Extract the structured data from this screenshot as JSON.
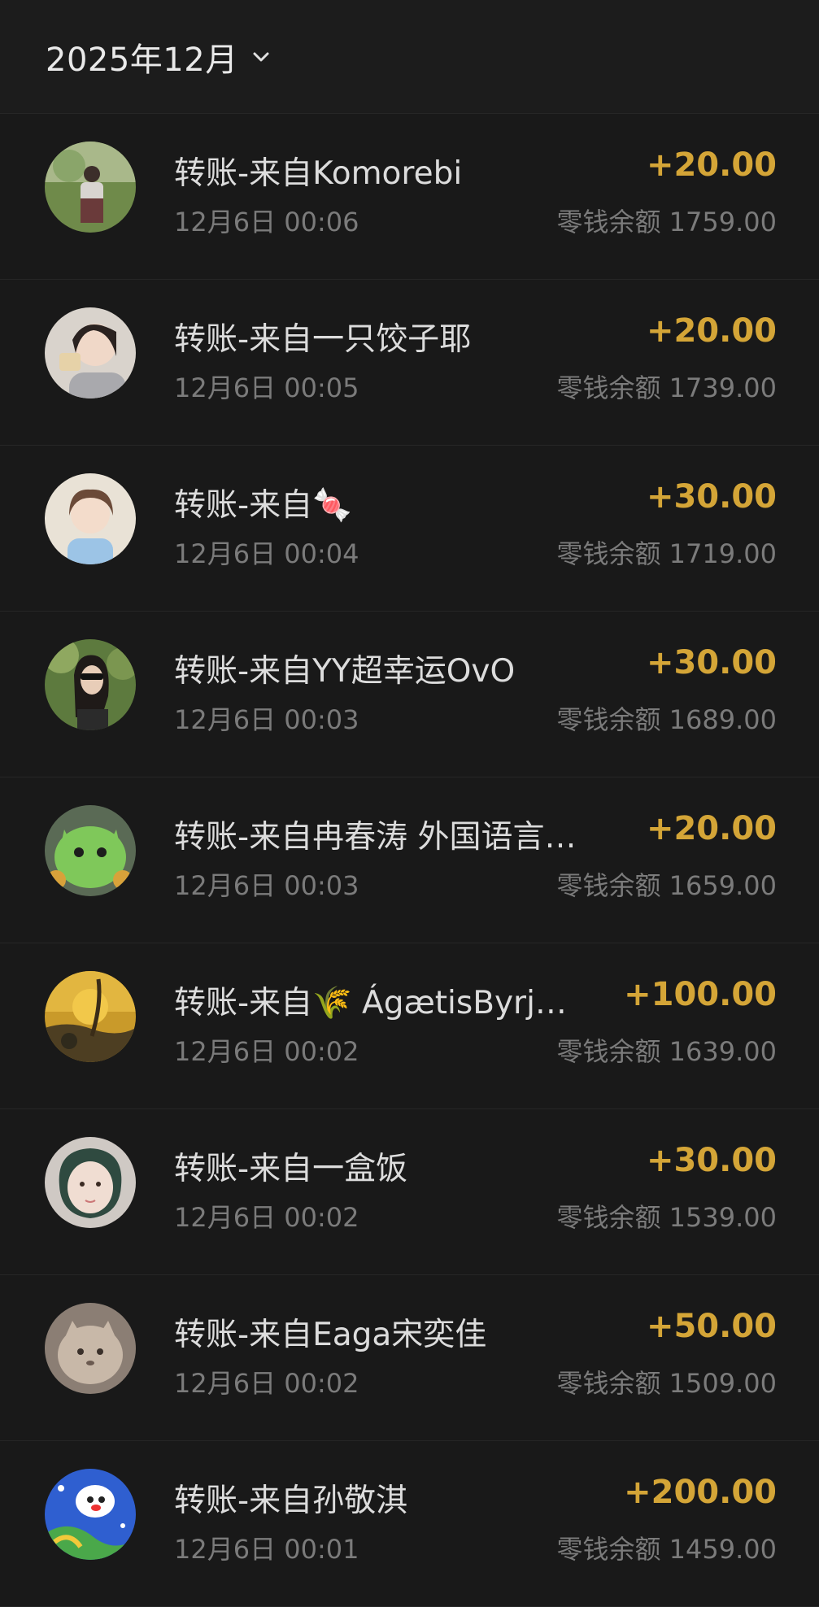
{
  "header": {
    "month_label": "2025年12月",
    "chevron_icon": "chevron-down-icon"
  },
  "colors": {
    "amount": "#d4a537",
    "background": "#191919",
    "header_background": "#1c1c1c"
  },
  "transactions": [
    {
      "title": "转账-来自Komorebi",
      "time": "12月6日 00:06",
      "amount": "+20.00",
      "balance": "零钱余额 1759.00"
    },
    {
      "title": "转账-来自一只饺子耶",
      "time": "12月6日 00:05",
      "amount": "+20.00",
      "balance": "零钱余额 1739.00"
    },
    {
      "title": "转账-来自🍬",
      "time": "12月6日 00:04",
      "amount": "+30.00",
      "balance": "零钱余额 1719.00"
    },
    {
      "title": "转账-来自YY超幸运OvO",
      "time": "12月6日 00:03",
      "amount": "+30.00",
      "balance": "零钱余额 1689.00"
    },
    {
      "title": "转账-来自冉春涛 外国语言…",
      "time": "12月6日 00:03",
      "amount": "+20.00",
      "balance": "零钱余额 1659.00"
    },
    {
      "title": "转账-来自🌾 ÁgætisByrj…",
      "time": "12月6日 00:02",
      "amount": "+100.00",
      "balance": "零钱余额 1639.00"
    },
    {
      "title": "转账-来自一盒饭",
      "time": "12月6日 00:02",
      "amount": "+30.00",
      "balance": "零钱余额 1539.00"
    },
    {
      "title": "转账-来自Eaga宋奕佳",
      "time": "12月6日 00:02",
      "amount": "+50.00",
      "balance": "零钱余额 1509.00"
    },
    {
      "title": "转账-来自孙敬淇",
      "time": "12月6日 00:01",
      "amount": "+200.00",
      "balance": "零钱余额 1459.00"
    }
  ]
}
